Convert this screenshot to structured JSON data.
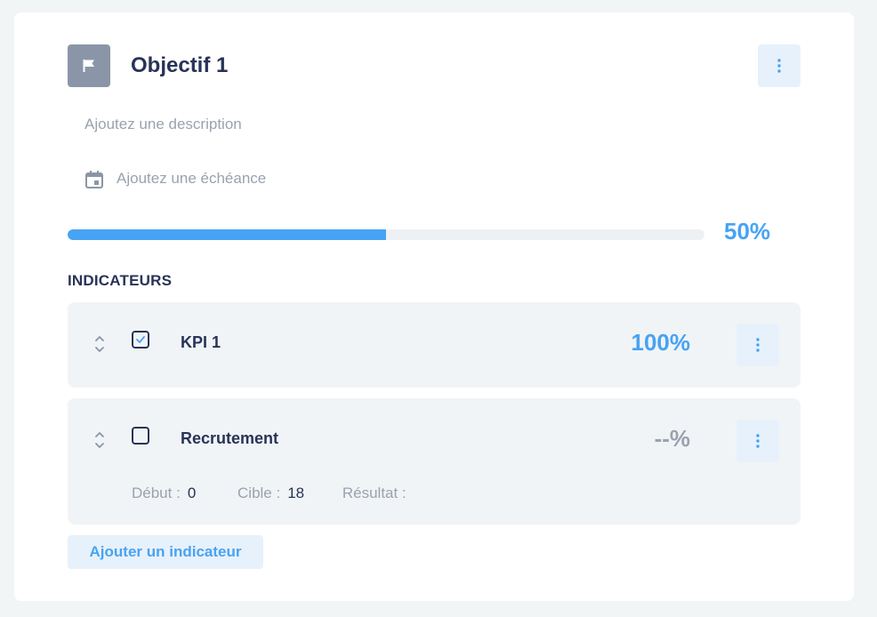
{
  "objective": {
    "title": "Objectif 1",
    "description_placeholder": "Ajoutez une description",
    "deadline_placeholder": "Ajoutez une échéance",
    "progress": 0.5,
    "progress_label": "50%"
  },
  "indicators_section": {
    "title": "INDICATEURS",
    "add_button_label": "Ajouter un indicateur"
  },
  "indicators": [
    {
      "name": "KPI 1",
      "checked": true,
      "percent_label": "100%"
    },
    {
      "name": "Recrutement",
      "checked": false,
      "percent_label": "--%",
      "start_label": "Début :",
      "start_value": "0",
      "target_label": "Cible :",
      "target_value": "18",
      "result_label": "Résultat :",
      "result_value": ""
    }
  ],
  "icons": {
    "objective": "flag-icon",
    "deadline": "calendar-icon",
    "menu": "more-vertical-icon",
    "drag": "drag-handle-icon",
    "checked": "check-icon"
  },
  "colors": {
    "accent": "#47a3f3",
    "text": "#283357",
    "muted": "#9aa2af",
    "flag_bg": "#8a96a8",
    "button_bg": "#e7f1fb",
    "row_bg": "#f1f4f6"
  }
}
